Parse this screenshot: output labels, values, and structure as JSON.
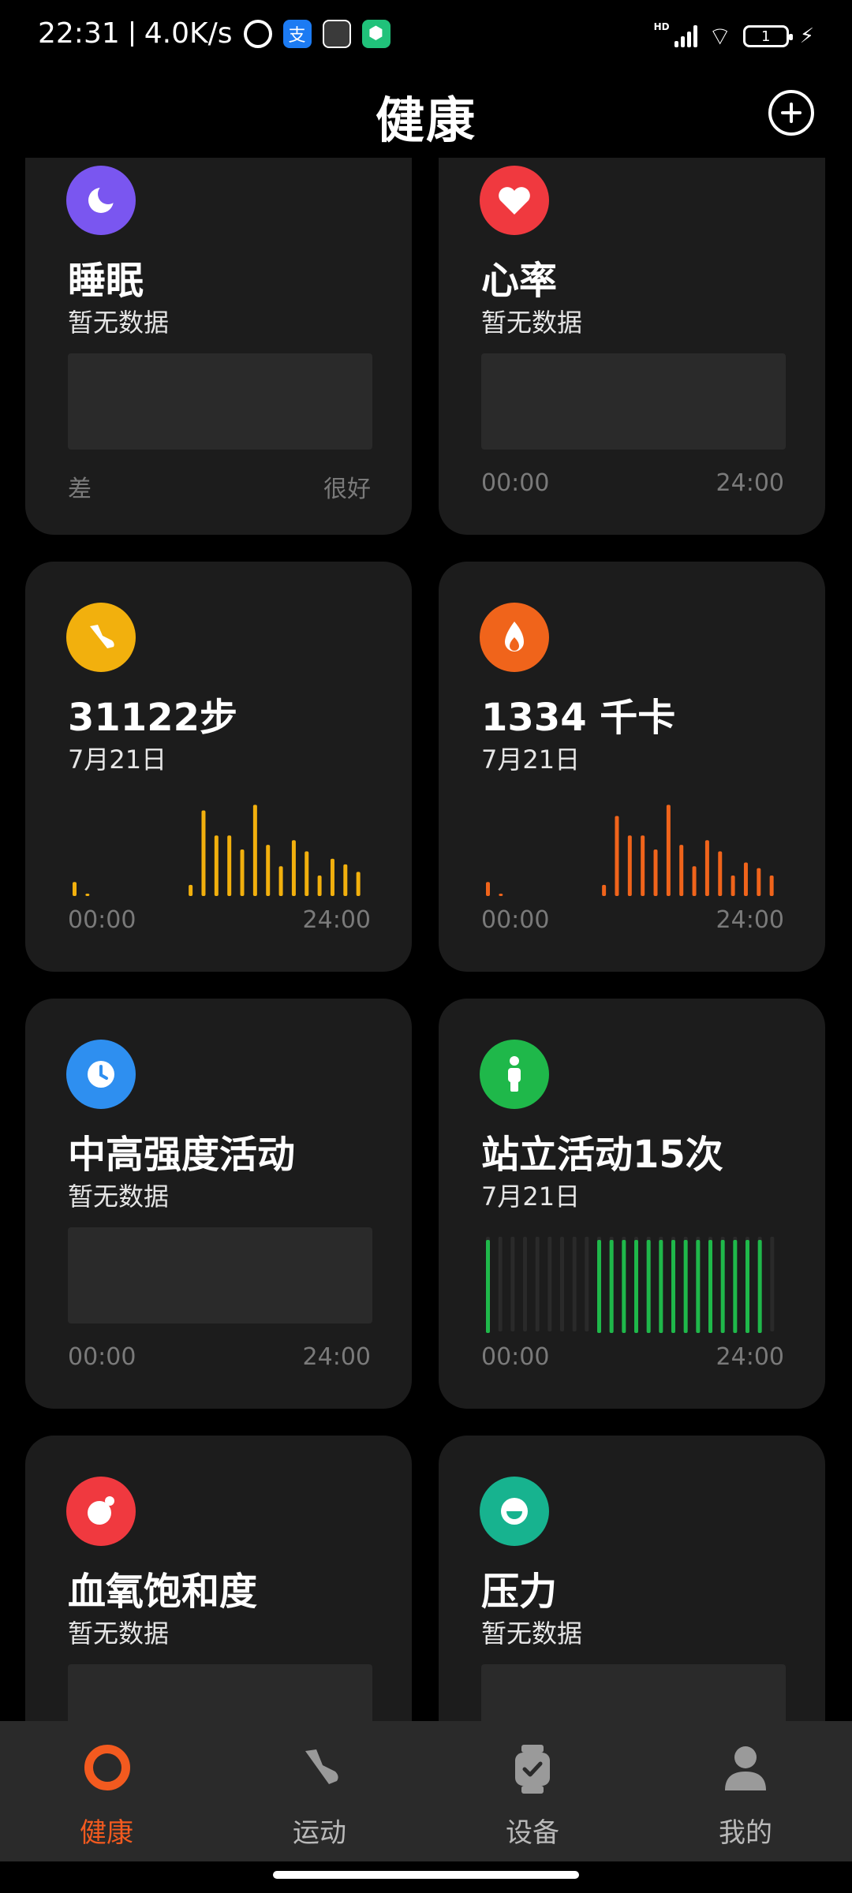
{
  "status": {
    "time": "22:31",
    "speed": "4.0K/s",
    "battery": "1",
    "network": "HD"
  },
  "header": {
    "title": "健康"
  },
  "cards": [
    {
      "title": "睡眠",
      "subtitle": "暂无数据",
      "label_left": "差",
      "label_right": "很好",
      "accent": "#7a56f0",
      "icon": "moon-icon"
    },
    {
      "title": "心率",
      "subtitle": "暂无数据",
      "label_left": "00:00",
      "label_right": "24:00",
      "accent": "#f0393f",
      "icon": "heart-icon"
    },
    {
      "title": "31122步",
      "subtitle": "7月21日",
      "label_left": "00:00",
      "label_right": "24:00",
      "accent": "#f2b00d",
      "icon": "shoe-icon",
      "chart_data": {
        "type": "bar",
        "values": [
          0.15,
          0.02,
          0,
          0,
          0,
          0,
          0,
          0,
          0,
          0.12,
          0.92,
          0.65,
          0.65,
          0.5,
          0.98,
          0.55,
          0.32,
          0.6,
          0.48,
          0.22,
          0.4,
          0.34,
          0.26
        ]
      }
    },
    {
      "title": "1334 千卡",
      "subtitle": "7月21日",
      "label_left": "00:00",
      "label_right": "24:00",
      "accent": "#f0641b",
      "icon": "flame-icon",
      "chart_data": {
        "type": "bar",
        "values": [
          0.15,
          0.02,
          0,
          0,
          0,
          0,
          0,
          0,
          0,
          0.12,
          0.86,
          0.65,
          0.65,
          0.5,
          0.98,
          0.55,
          0.32,
          0.6,
          0.48,
          0.22,
          0.36,
          0.3,
          0.22
        ]
      }
    },
    {
      "title": "中高强度活动",
      "subtitle": "暂无数据",
      "label_left": "00:00",
      "label_right": "24:00",
      "accent": "#2e8ff0",
      "icon": "clock-icon"
    },
    {
      "title": "站立活动15次",
      "subtitle": "7月21日",
      "label_left": "00:00",
      "label_right": "24:00",
      "accent": "#1fb84a",
      "icon": "standing-person-icon",
      "chart_data": {
        "type": "bar",
        "values": [
          1,
          0,
          0,
          0,
          0,
          0,
          0,
          0,
          0,
          1,
          1,
          1,
          1,
          1,
          1,
          1,
          1,
          1,
          1,
          1,
          1,
          1,
          1,
          0
        ]
      }
    },
    {
      "title": "血氧饱和度",
      "subtitle": "暂无数据",
      "accent": "#f0393f",
      "icon": "blood-oxygen-icon"
    },
    {
      "title": "压力",
      "subtitle": "暂无数据",
      "accent": "#17b38f",
      "icon": "face-icon"
    }
  ],
  "nav": [
    {
      "label": "健康",
      "icon": "ring-icon",
      "active": true
    },
    {
      "label": "运动",
      "icon": "shoe-icon",
      "active": false
    },
    {
      "label": "设备",
      "icon": "watch-icon",
      "active": false
    },
    {
      "label": "我的",
      "icon": "person-icon",
      "active": false
    }
  ]
}
